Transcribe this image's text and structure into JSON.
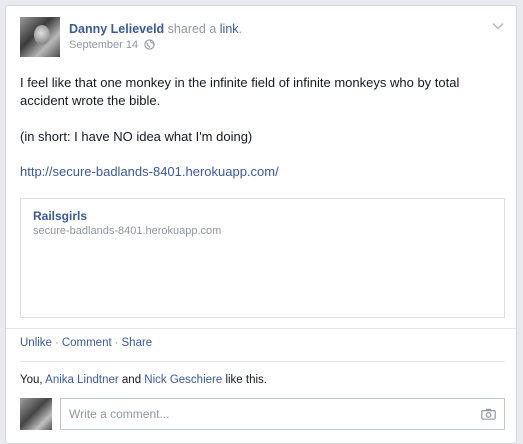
{
  "post": {
    "author": "Danny Lelieveld",
    "action_prefix": " shared a ",
    "action_link": "link",
    "action_suffix": ".",
    "date": "September 14",
    "body_line1": "I feel like that one monkey in the infinite field of infinite monkeys who by total accident wrote the bible.",
    "body_line2": "(in short: I have NO idea what I'm doing)",
    "link_url": "http://secure-badlands-8401.herokuapp.com/"
  },
  "attachment": {
    "title": "Railsgirls",
    "url": "secure-badlands-8401.herokuapp.com"
  },
  "actions": {
    "unlike": "Unlike",
    "comment": "Comment",
    "share": "Share",
    "separator": "·"
  },
  "likes": {
    "you": "You,",
    "name1": "Anika Lindtner",
    "and": " and ",
    "name2": "Nick Geschiere",
    "suffix": " like this."
  },
  "comment_input": {
    "placeholder": "Write a comment..."
  },
  "icons": {
    "audience": "globe-icon",
    "menu": "chevron-down-icon",
    "attach_photo": "camera-icon"
  },
  "colors": {
    "link": "#3b5998",
    "muted": "#9197a3",
    "border": "#d3d6db"
  }
}
